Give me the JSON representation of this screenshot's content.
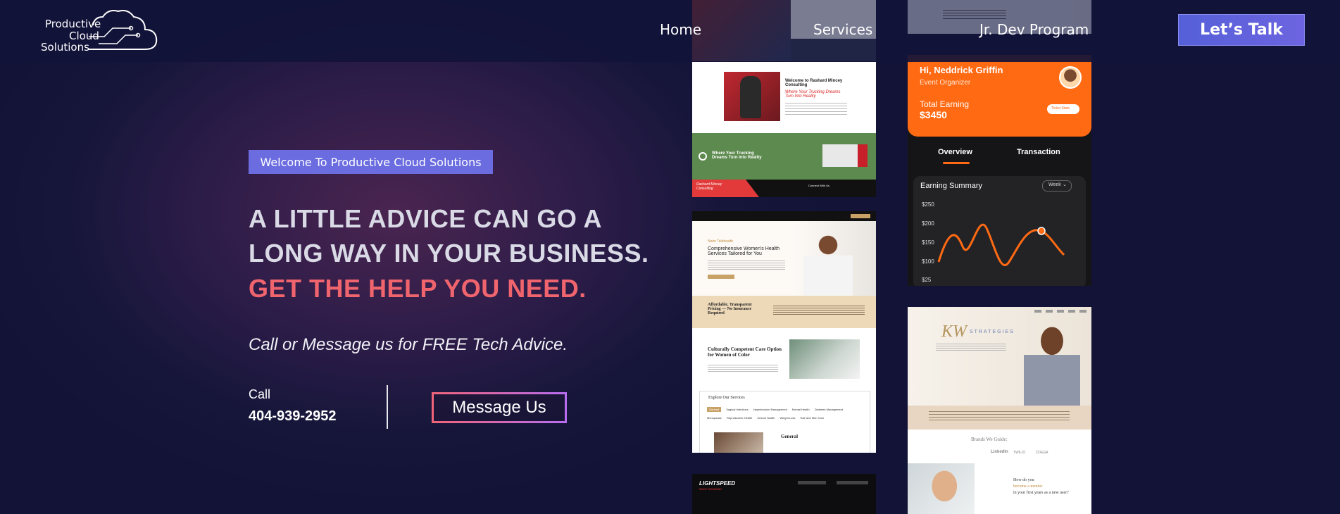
{
  "header": {
    "logo_lines": [
      "Productive",
      "Cloud",
      "Solutions"
    ],
    "nav": [
      "Home",
      "Services",
      "Jr. Dev Program"
    ],
    "cta_label": "Let’s Talk"
  },
  "hero": {
    "badge": "Welcome To Productive Cloud Solutions",
    "headline_lines": [
      "A LITTLE ADVICE CAN GO A",
      "LONG WAY IN YOUR BUSINESS."
    ],
    "headline_accent": "GET THE HELP YOU NEED.",
    "subtitle": "Call or Message us for FREE Tech Advice.",
    "call_label": "Call",
    "phone": "404-939-2952",
    "message_button": "Message Us"
  },
  "showcase": {
    "trucking": {
      "title": "Welcome to Rashard Mincey Consulting",
      "subtitle_red": "Where Your Trucking Dreams Turn Into Reality",
      "banner": "Where Your Trucking Dreams Turn Into Reality",
      "footer_name": "Rashard Mincey Consulting",
      "footer_contact": "Connect With Us"
    },
    "app": {
      "greeting": "Hi, Neddrick Griffin",
      "role": "Event Organizer",
      "earning_label": "Total Earning",
      "earning_value": "$3450",
      "ticket_button": "Ticket Stats",
      "tab_overview": "Overview",
      "tab_transaction": "Transaction",
      "summary_title": "Earning Summary",
      "period": "Week",
      "y_ticks": [
        "$250",
        "$200",
        "$150",
        "$100",
        "$25"
      ]
    },
    "health": {
      "tag": "Noire Telehealth",
      "heading": "Comprehensive Women's Health Services Tailored for You",
      "affordable": "Affordable, Transparent Pricing — No Insurance Required",
      "culture": "Culturally Competent Care Option for Women of Color",
      "explore": "Explore Our Services",
      "services": [
        "General",
        "Vaginal Infections",
        "Hypertension Management",
        "Mental Health",
        "Diabetes Management",
        "Menopause",
        "Reproductive Health",
        "Sexual Health",
        "Weight Loss",
        "Hair and Skin Care"
      ],
      "general": "General"
    },
    "kw": {
      "brand": "STRATEGIES",
      "brands_title": "Brands We Guide:",
      "brand_logos": [
        "LinkedIn",
        "TWILIO",
        "ZOEGA"
      ],
      "how_line1": "How do you",
      "how_line2": "become a mentor",
      "how_line3": "in your first years as a new user?"
    },
    "racing": {
      "brand": "LIGHTSPEED",
      "sub": "RACE ROADWAY"
    }
  },
  "colors": {
    "accent_red": "#f0646e",
    "badge_bg": "#6a6ce0",
    "cta_bg": "#5560d8",
    "app_orange": "#ff6a13"
  }
}
